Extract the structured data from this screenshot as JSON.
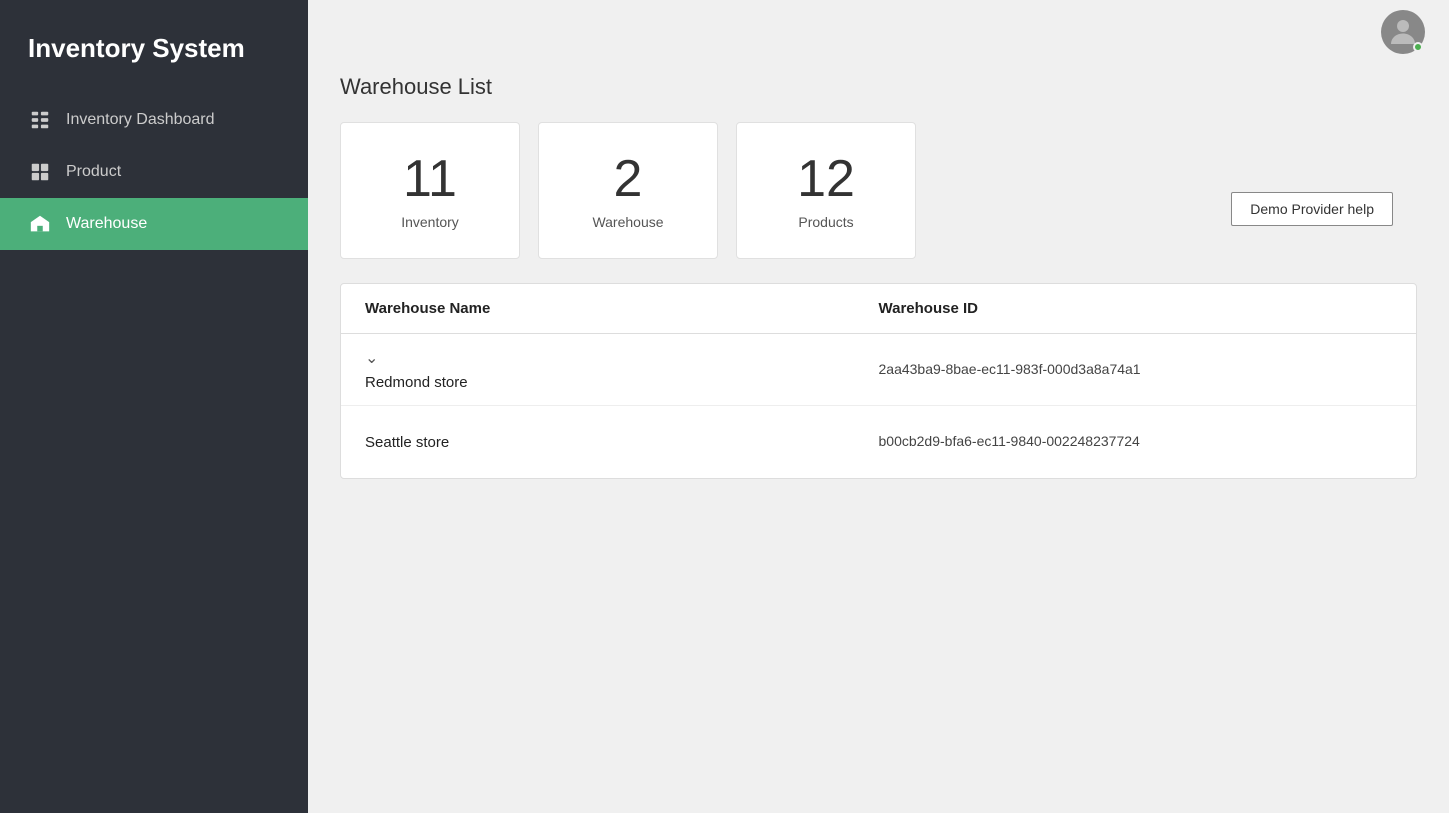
{
  "app": {
    "title": "Inventory System"
  },
  "sidebar": {
    "items": [
      {
        "id": "inventory-dashboard",
        "label": "Inventory Dashboard",
        "icon": "dashboard-icon",
        "active": false
      },
      {
        "id": "product",
        "label": "Product",
        "icon": "product-icon",
        "active": false
      },
      {
        "id": "warehouse",
        "label": "Warehouse",
        "icon": "warehouse-icon",
        "active": true
      }
    ]
  },
  "header": {
    "help_button_label": "Demo Provider help"
  },
  "main": {
    "page_title": "Warehouse List",
    "stats": [
      {
        "number": "11",
        "label": "Inventory"
      },
      {
        "number": "2",
        "label": "Warehouse"
      },
      {
        "number": "12",
        "label": "Products"
      }
    ],
    "table": {
      "columns": [
        {
          "key": "name",
          "label": "Warehouse Name"
        },
        {
          "key": "id",
          "label": "Warehouse ID"
        }
      ],
      "rows": [
        {
          "name": "Redmond store",
          "id": "2aa43ba9-8bae-ec11-983f-000d3a8a74a1"
        },
        {
          "name": "Seattle store",
          "id": "b00cb2d9-bfa6-ec11-9840-002248237724"
        }
      ]
    }
  }
}
